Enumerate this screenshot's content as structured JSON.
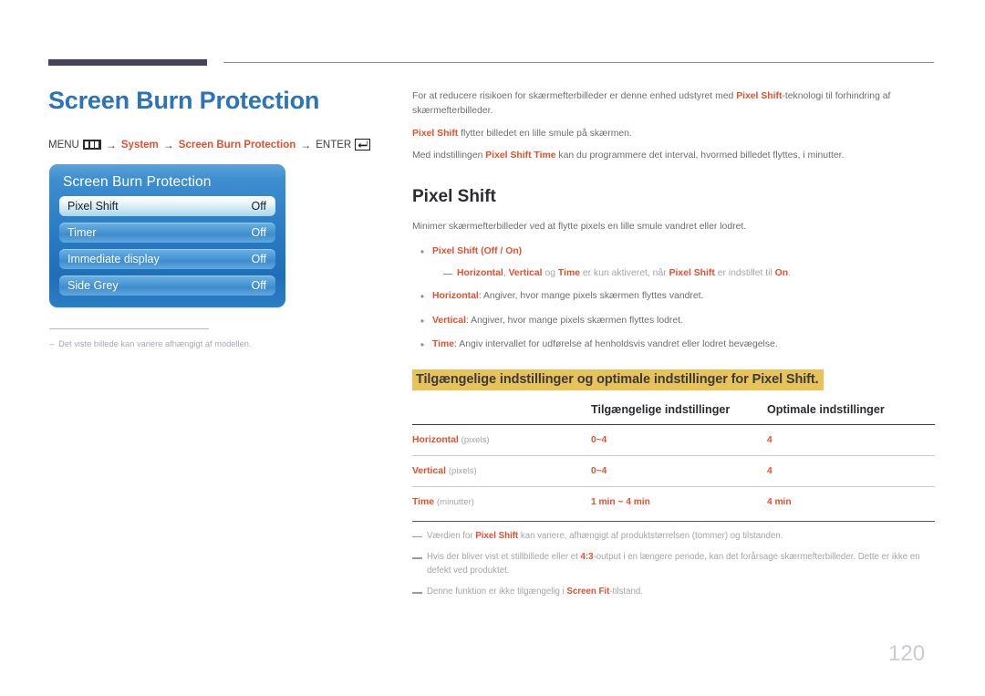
{
  "page_title": "Screen Burn Protection",
  "breadcrumb": {
    "menu_label": "MENU",
    "menu_icon": "menu-bars-icon",
    "arrow": "→",
    "step1": "System",
    "step2": "Screen Burn Protection",
    "enter_label": "ENTER",
    "enter_icon": "enter-return-icon"
  },
  "osd": {
    "title": "Screen Burn Protection",
    "rows": [
      {
        "label": "Pixel Shift",
        "value": "Off",
        "selected": true
      },
      {
        "label": "Timer",
        "value": "Off",
        "selected": false
      },
      {
        "label": "Immediate display",
        "value": "Off",
        "selected": false
      },
      {
        "label": "Side Grey",
        "value": "Off",
        "selected": false
      }
    ]
  },
  "left_note": {
    "dash": "–",
    "text": "Det viste billede kan variere afhængigt af modellen."
  },
  "intro": {
    "p1_a": "For at reducere risikoen for skærmefterbilleder er denne enhed udstyret med ",
    "p1_acc": "Pixel Shift",
    "p1_b": "-teknologi til forhindring af skærmefterbilleder.",
    "p2_acc": "Pixel Shift",
    "p2_b": " flytter billedet en lille smule på skærmen.",
    "p3_a": "Med indstillingen ",
    "p3_acc": "Pixel Shift Time",
    "p3_b": " kan du programmere det interval, hvormed billedet flyttes, i minutter."
  },
  "section": {
    "title": "Pixel Shift",
    "lead": "Minimer skærmefterbilleder ved at flytte pixels en lille smule vandret eller lodret."
  },
  "bullets": [
    {
      "dot": "•",
      "acc": "Pixel Shift",
      "rest": " (Off / On)",
      "rest_acc_parts": [
        "Off",
        "On"
      ]
    },
    {
      "dot": "•",
      "acc": "Horizontal",
      "rest": ": Angiver, hvor mange pixels skærmen flyttes vandret."
    },
    {
      "dot": "•",
      "acc": "Vertical",
      "rest": ": Angiver, hvor mange pixels skærmen flyttes lodret."
    },
    {
      "dot": "•",
      "acc": "Time",
      "rest": ": Angiv intervallet for udførelse af henholdsvis vandret eller lodret bevægelse."
    }
  ],
  "subnote": {
    "a1": "Horizontal",
    "sep1": ", ",
    "a2": "Vertical",
    "mid1": " og ",
    "a3": "Time",
    "mid2": " er kun aktiveret, når ",
    "a4": "Pixel Shift",
    "mid3": " er indstillet til ",
    "a5": "On",
    "end": "."
  },
  "banner": "Tilgængelige indstillinger og optimale indstillinger for Pixel Shift.",
  "table": {
    "headers": [
      "",
      "Tilgængelige indstillinger",
      "Optimale indstillinger"
    ],
    "rows": [
      {
        "label": "Horizontal",
        "unit": "(pixels)",
        "available": "0~4",
        "optimal": "4"
      },
      {
        "label": "Vertical",
        "unit": "(pixels)",
        "available": "0~4",
        "optimal": "4"
      },
      {
        "label": "Time",
        "unit": "(minutter)",
        "available": "1 min ~ 4 min",
        "optimal": "4 min"
      }
    ]
  },
  "footnotes": [
    {
      "a": "Værdien for ",
      "acc": "Pixel Shift",
      "b": " kan variere, afhængigt af produktstørrelsen (tommer) og tilstanden."
    },
    {
      "a": "Hvis der bliver vist et stillbillede eller et ",
      "acc": "4:3",
      "b": "-output i en længere periode, kan det forårsage skærmefterbilleder. Dette er ikke en defekt ved produktet."
    },
    {
      "a": "Denne funktion er ikke tilgængelig i ",
      "acc": "Screen Fit",
      "b": "-tilstand."
    }
  ],
  "page_number": "120",
  "colors": {
    "title_blue": "#2b74b8",
    "accent_orange": "#e0512f",
    "banner_gold": "#e8c35a",
    "body_gray": "#6d6d72",
    "rule_dark": "#464459"
  }
}
